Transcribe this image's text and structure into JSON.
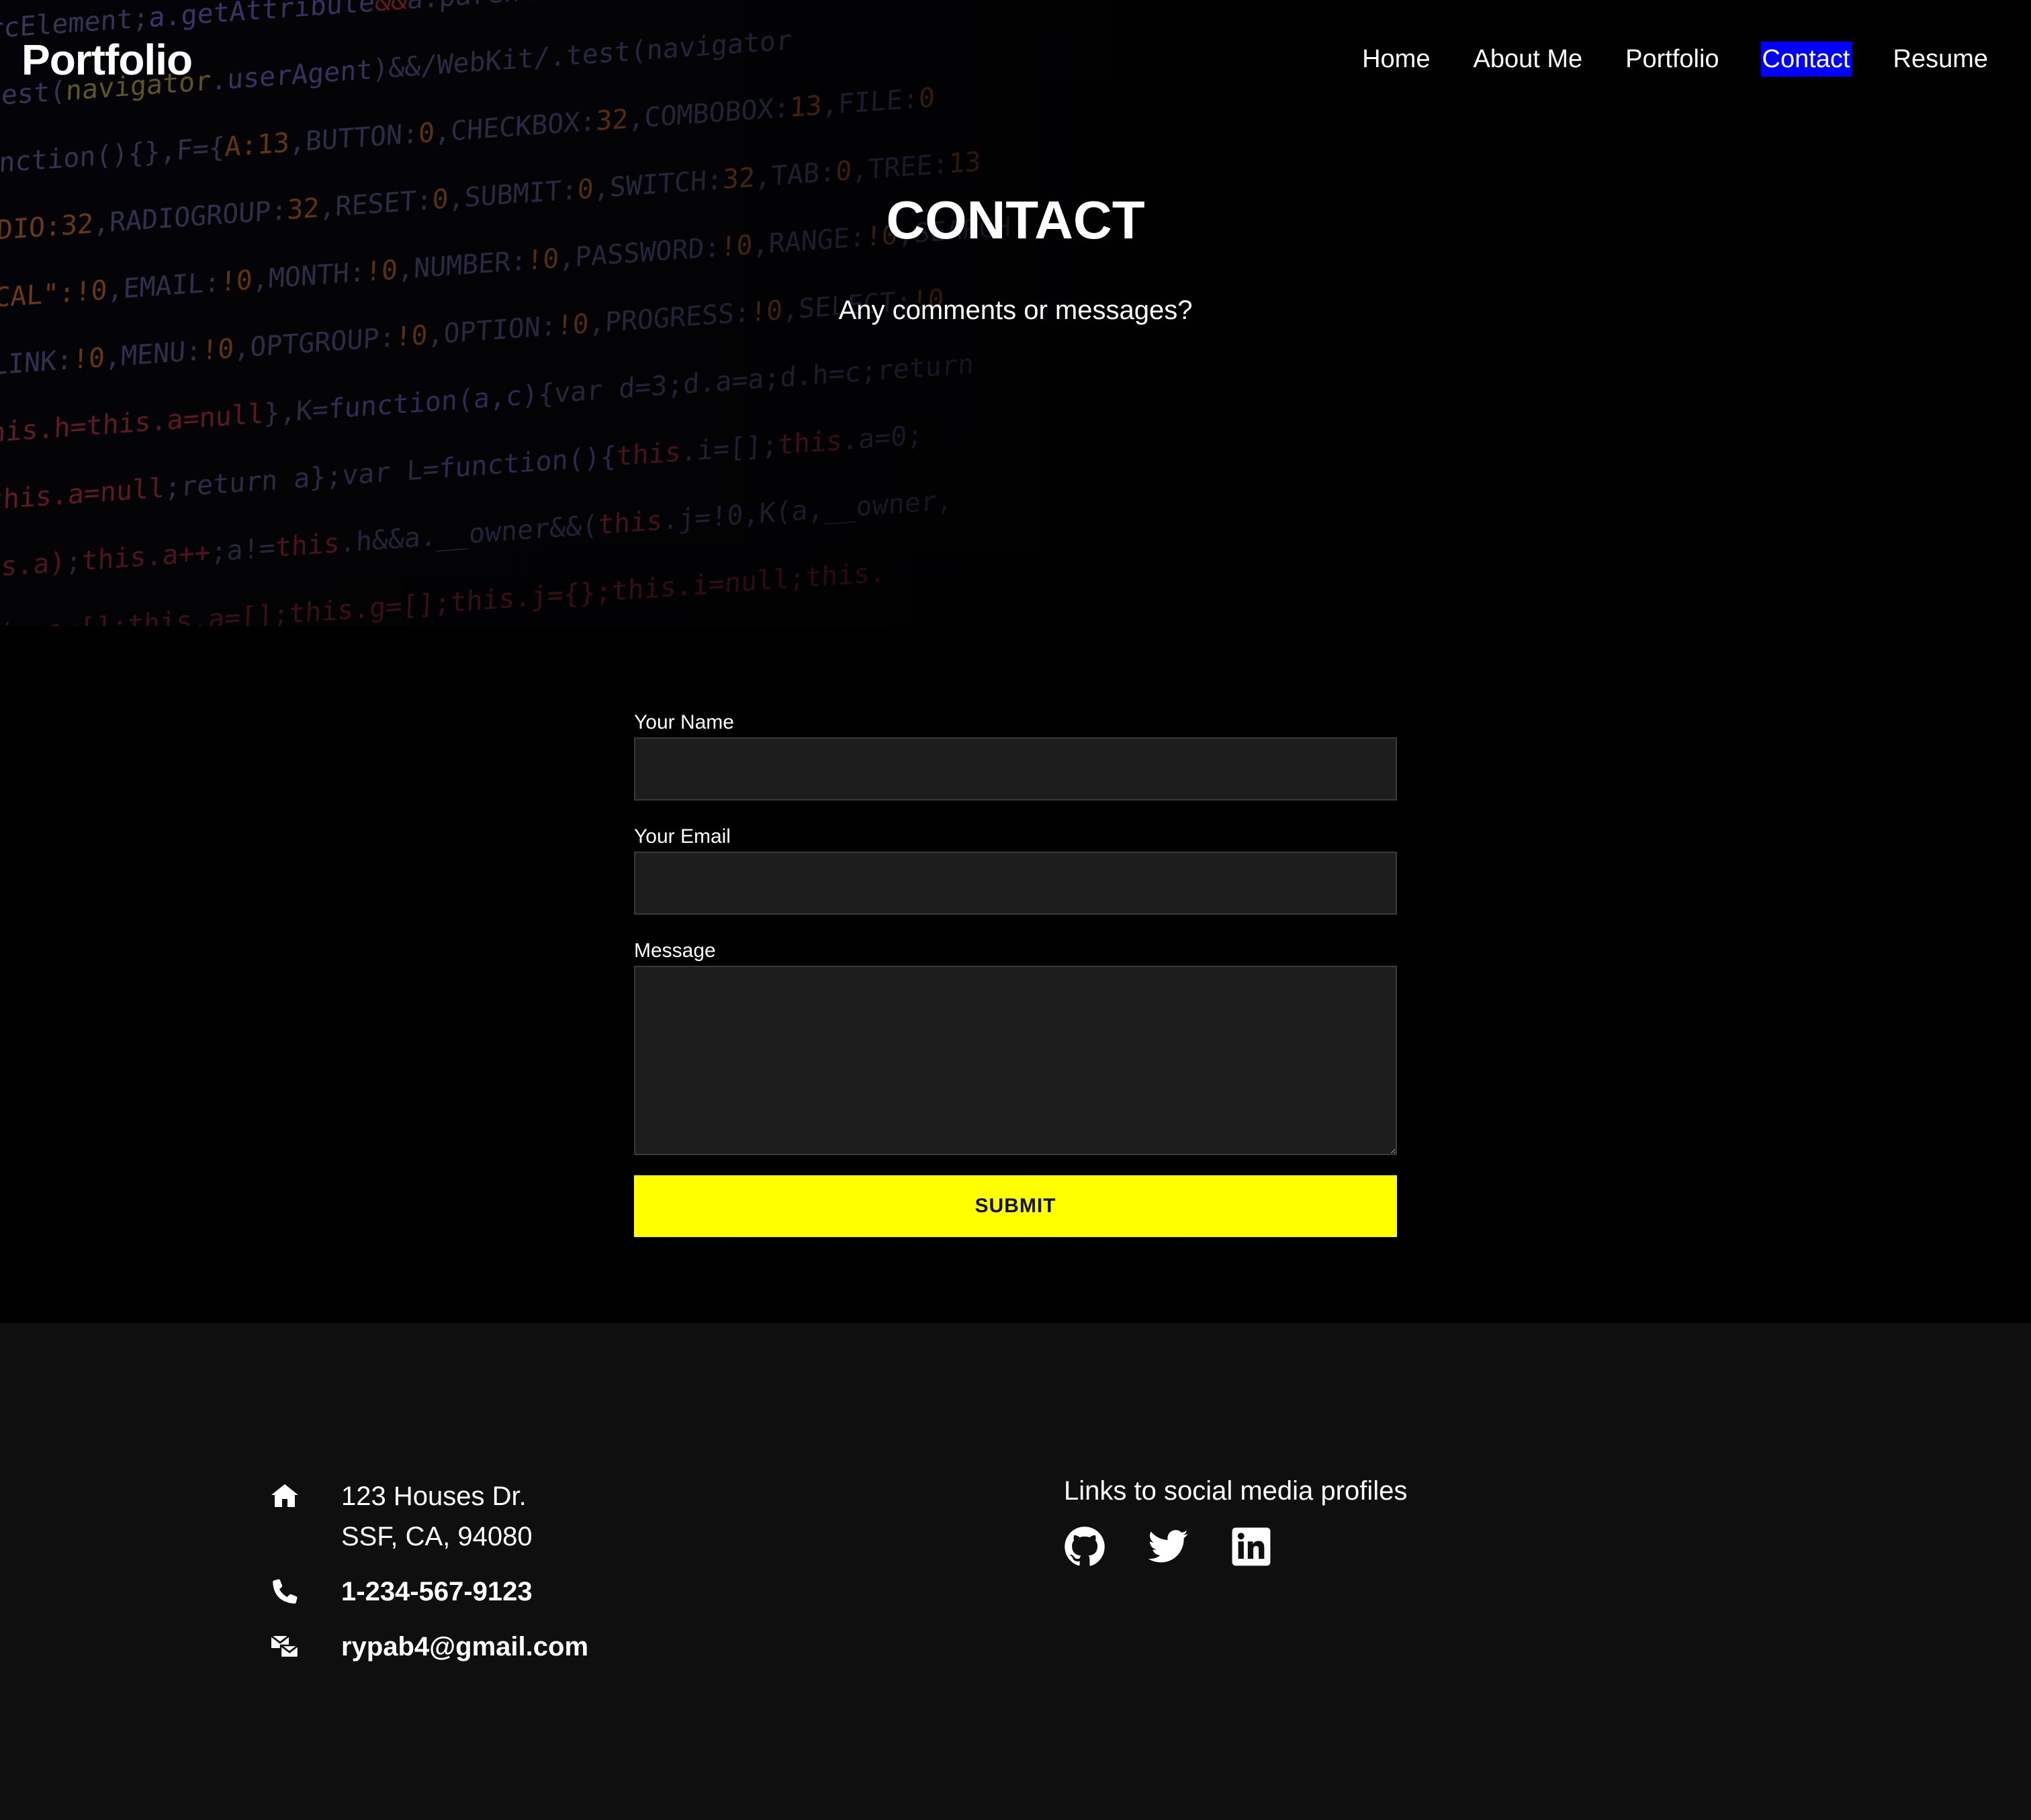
{
  "header": {
    "brand": "Portfolio",
    "nav": [
      {
        "label": "Home",
        "active": false
      },
      {
        "label": "About Me",
        "active": false
      },
      {
        "label": "Portfolio",
        "active": false
      },
      {
        "label": "Contact",
        "active": true
      },
      {
        "label": "Resume",
        "active": false
      }
    ]
  },
  "hero": {
    "title": "CONTACT",
    "subtitle": "Any comments or messages?"
  },
  "form": {
    "name_label": "Your Name",
    "name_value": "",
    "email_label": "Your Email",
    "email_value": "",
    "message_label": "Message",
    "message_value": "",
    "submit_label": "SUBMIT"
  },
  "footer": {
    "address_line1": "123 Houses Dr.",
    "address_line2": "SSF, CA, 94080",
    "phone": "1-234-567-9123",
    "email": "rypab4@gmail.com",
    "social_title": "Links to social media profiles",
    "social_icons": [
      "github-icon",
      "twitter-icon",
      "linkedin-icon"
    ]
  },
  "colors": {
    "active_nav_bg": "#0000ff",
    "submit_bg": "#ffff00",
    "footer_bg": "#0f0f10",
    "input_bg": "#1d1d1d"
  }
}
